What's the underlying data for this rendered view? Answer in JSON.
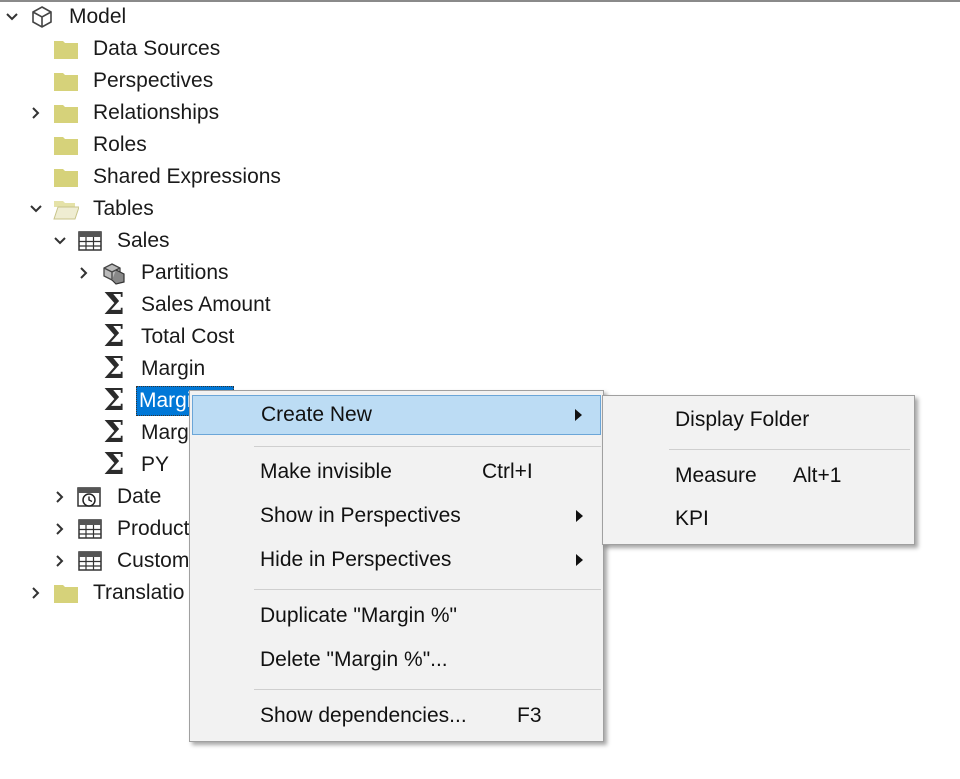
{
  "tree": {
    "model": "Model",
    "data_sources": "Data Sources",
    "perspectives": "Perspectives",
    "relationships": "Relationships",
    "roles": "Roles",
    "shared_expressions": "Shared Expressions",
    "tables": "Tables",
    "sales": "Sales",
    "partitions": "Partitions",
    "sales_amount": "Sales Amount",
    "total_cost": "Total Cost",
    "margin": "Margin",
    "margin_pct_selected": "Margi",
    "margin_other": "Margi",
    "py": "PY",
    "date": "Date",
    "product": "Product",
    "customer": "Custom",
    "translations": "Translatio"
  },
  "context_menu": {
    "create_new": "Create New",
    "make_invisible": "Make invisible",
    "make_invisible_shortcut": "Ctrl+I",
    "show_in_perspectives": "Show in Perspectives",
    "hide_in_perspectives": "Hide in Perspectives",
    "duplicate": "Duplicate \"Margin %\"",
    "delete": "Delete \"Margin %\"...",
    "show_dependencies": "Show dependencies...",
    "show_dependencies_shortcut": "F3"
  },
  "submenu": {
    "display_folder": "Display Folder",
    "measure": "Measure",
    "measure_shortcut": "Alt+1",
    "kpi": "KPI"
  },
  "colors": {
    "folder": "#d6d27a",
    "selection": "#0078d7",
    "menu_highlight": "#bcdcf4",
    "menu_bg": "#f2f2f2"
  }
}
